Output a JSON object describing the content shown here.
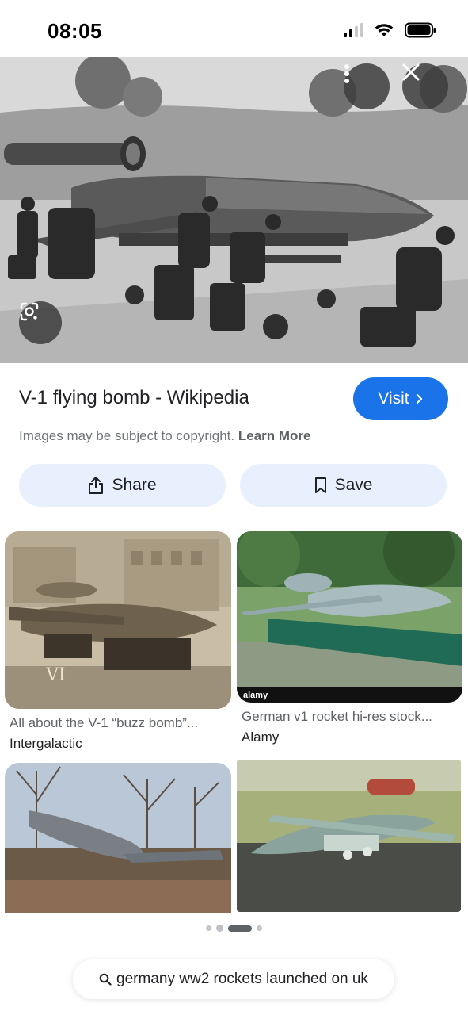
{
  "status_bar": {
    "time": "08:05"
  },
  "hero": {
    "more_icon": "more-vert-icon",
    "close_icon": "close-icon",
    "lens_icon": "lens-icon"
  },
  "result": {
    "title": "V-1 flying bomb - Wikipedia",
    "visit_label": "Visit",
    "copyright_text": "Images may be subject to copyright.",
    "learn_more": "Learn More",
    "share_label": "Share",
    "save_label": "Save"
  },
  "related": [
    {
      "caption": "All about the V-1 “buzz bomb”...",
      "source": "Intergalactic"
    },
    {
      "caption": "German v1 rocket hi-res stock...",
      "source": "Alamy",
      "watermark": "alamy"
    },
    {
      "caption": "",
      "source": ""
    },
    {
      "caption": "",
      "source": ""
    }
  ],
  "photo_marks": {
    "v1_label": "VI"
  },
  "search_chip": {
    "query": "germany ww2 rockets launched on uk"
  },
  "colors": {
    "accent": "#1a73e8",
    "pill_bg": "#e8f0fe"
  }
}
